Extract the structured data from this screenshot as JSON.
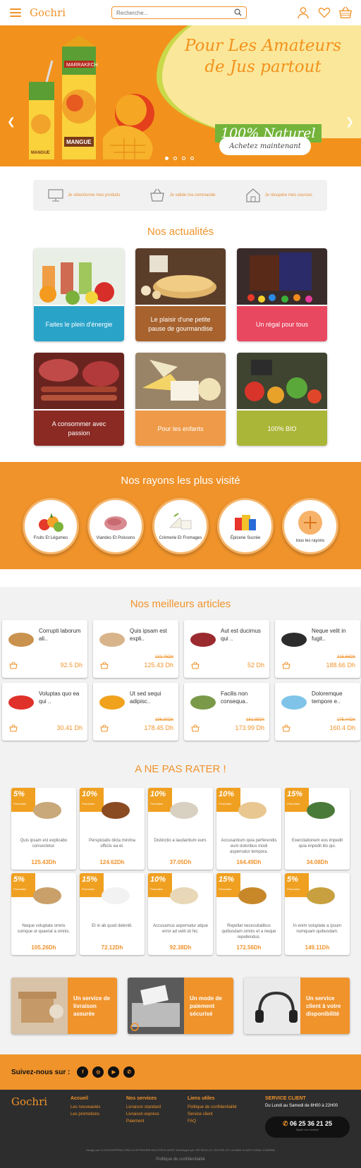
{
  "header": {
    "logo": "Gochri",
    "search_placeholder": "Recherche...",
    "icons": [
      "menu-icon",
      "search-icon",
      "user-icon",
      "heart-icon",
      "basket-icon"
    ]
  },
  "hero": {
    "headline_line1": "Pour Les Amateurs",
    "headline_line2": "de Jus partout",
    "badge": "100% Naturel",
    "cta": "Achetez maintenant",
    "slide_count": 4,
    "active_slide": 1
  },
  "steps": [
    {
      "icon": "computer-icon",
      "label": "Je sélectionne mes produits"
    },
    {
      "icon": "basket-icon",
      "label": "Je valide ma commande"
    },
    {
      "icon": "house-icon",
      "label": "Je récupère mes courses"
    }
  ],
  "news": {
    "title": "Nos actualités",
    "cards": [
      {
        "label": "Faites le plein d'énergie",
        "color": "#2aa3c9"
      },
      {
        "label": "Le plaisir d'une petite pause de gourmandise",
        "color": "#a7622d"
      },
      {
        "label": "Un régal pour tous",
        "color": "#e84860"
      },
      {
        "label": "A consommer avec passion",
        "color": "#8b2a23"
      },
      {
        "label": "Pour les enfants",
        "color": "#ef9a48"
      },
      {
        "label": "100% BIO",
        "color": "#aab637"
      }
    ]
  },
  "rayons": {
    "title": "Nos rayons les plus visité",
    "items": [
      {
        "label": "Fruits Et Légumes"
      },
      {
        "label": "Viandes Et Poissons"
      },
      {
        "label": "Crèmerie Et Fromages"
      },
      {
        "label": "Épicerie Sucrée"
      },
      {
        "label": "tous les rayons"
      }
    ]
  },
  "best": {
    "title": "Nos meilleurs articles",
    "items": [
      {
        "name": "Corrupti laborum ali..",
        "old": "",
        "price": "92.5 Dh"
      },
      {
        "name": "Quis ipsam est expli..",
        "old": "131.76Dh",
        "price": "125.43 Dh"
      },
      {
        "name": "Aut est ducimus qui ..",
        "old": "",
        "price": "52 Dh"
      },
      {
        "name": "Neque velit in fugit..",
        "old": "215.56Dh",
        "price": "188.66 Dh"
      },
      {
        "name": "Voluptas quo ea qui ..",
        "old": "",
        "price": "30.41 Dh"
      },
      {
        "name": "Ut sed sequi adipisc..",
        "old": "196.30Dh",
        "price": "178.45 Dh"
      },
      {
        "name": "Facilis non consequa..",
        "old": "181.35Dh",
        "price": "173.99 Dh"
      },
      {
        "name": "Doloremque tempore e..",
        "old": "175.44Dh",
        "price": "160.4 Dh"
      }
    ]
  },
  "deals": {
    "title": "A NE PAS RATER !",
    "promo_label": "Promotion",
    "items": [
      {
        "pct": "5%",
        "desc": "Quis ipsam est explicabo consectetur.",
        "price": "125.43Dh"
      },
      {
        "pct": "10%",
        "desc": "Perspiciatis dicta minima officiis ea et.",
        "price": "124.62Dh"
      },
      {
        "pct": "10%",
        "desc": "Distinctio a laudantium eum.",
        "price": "37.05Dh"
      },
      {
        "pct": "10%",
        "desc": "Accusantium quia perferendis eum doloribus modi aspernatur tempora.",
        "price": "164.49Dh"
      },
      {
        "pct": "15%",
        "desc": "Exercitationem eos impedit quia impedit illo qui.",
        "price": "34.08Dh"
      },
      {
        "pct": "5%",
        "desc": "Neque voluptate omnis cumque ut quaerat a omnis.",
        "price": "105.26Dh"
      },
      {
        "pct": "15%",
        "desc": "Et in ab quod deleniti.",
        "price": "72.12Dh"
      },
      {
        "pct": "10%",
        "desc": "Accusamus aspernatur atque error ad velit sit hic.",
        "price": "92.38Dh"
      },
      {
        "pct": "15%",
        "desc": "Repellat necessitatibus quibusdam omnis et a neque repellendus.",
        "price": "172.56Dh"
      },
      {
        "pct": "5%",
        "desc": "In enim voluptate a ipsum numquam quibusdam.",
        "price": "149.11Dh"
      }
    ]
  },
  "services": [
    {
      "label": "Un service de livraison assurée"
    },
    {
      "label": "Un mode de paiement sécurisé"
    },
    {
      "label": "Un service client à votre disponibilité"
    }
  ],
  "social": {
    "label": "Suivez-nous sur :",
    "icons": [
      "facebook-icon",
      "instagram-icon",
      "youtube-icon",
      "whatsapp-icon"
    ]
  },
  "footer": {
    "logo": "Gochri",
    "col1": {
      "title": "Accueil",
      "links": [
        "Les nouveautés",
        "Les promotions"
      ]
    },
    "col2": {
      "title": "Nos services",
      "links": [
        "Livraison standard",
        "Livraison express",
        "Paiement"
      ]
    },
    "col3": {
      "title": "Liens utiles",
      "links": [
        "Politique de confidentialité",
        "Service client",
        "FAQ"
      ]
    },
    "client": {
      "title": "SERVICE CLIENT",
      "hours": "Du Lundi au Samedi de 8H00 à 22H00",
      "phone": "06 25 36 21 25",
      "phone_note": "Appel non surtaxé"
    },
    "copyright": "Design par CLICKSHOPPING.ORG et OFFSHORE BOLDTECH ASSIT Développé par OFFSHOLLO, OKOTEL ET LA MAIN CLASS TURIAL CHARMA",
    "privacy": "Politique de confidentialité"
  }
}
